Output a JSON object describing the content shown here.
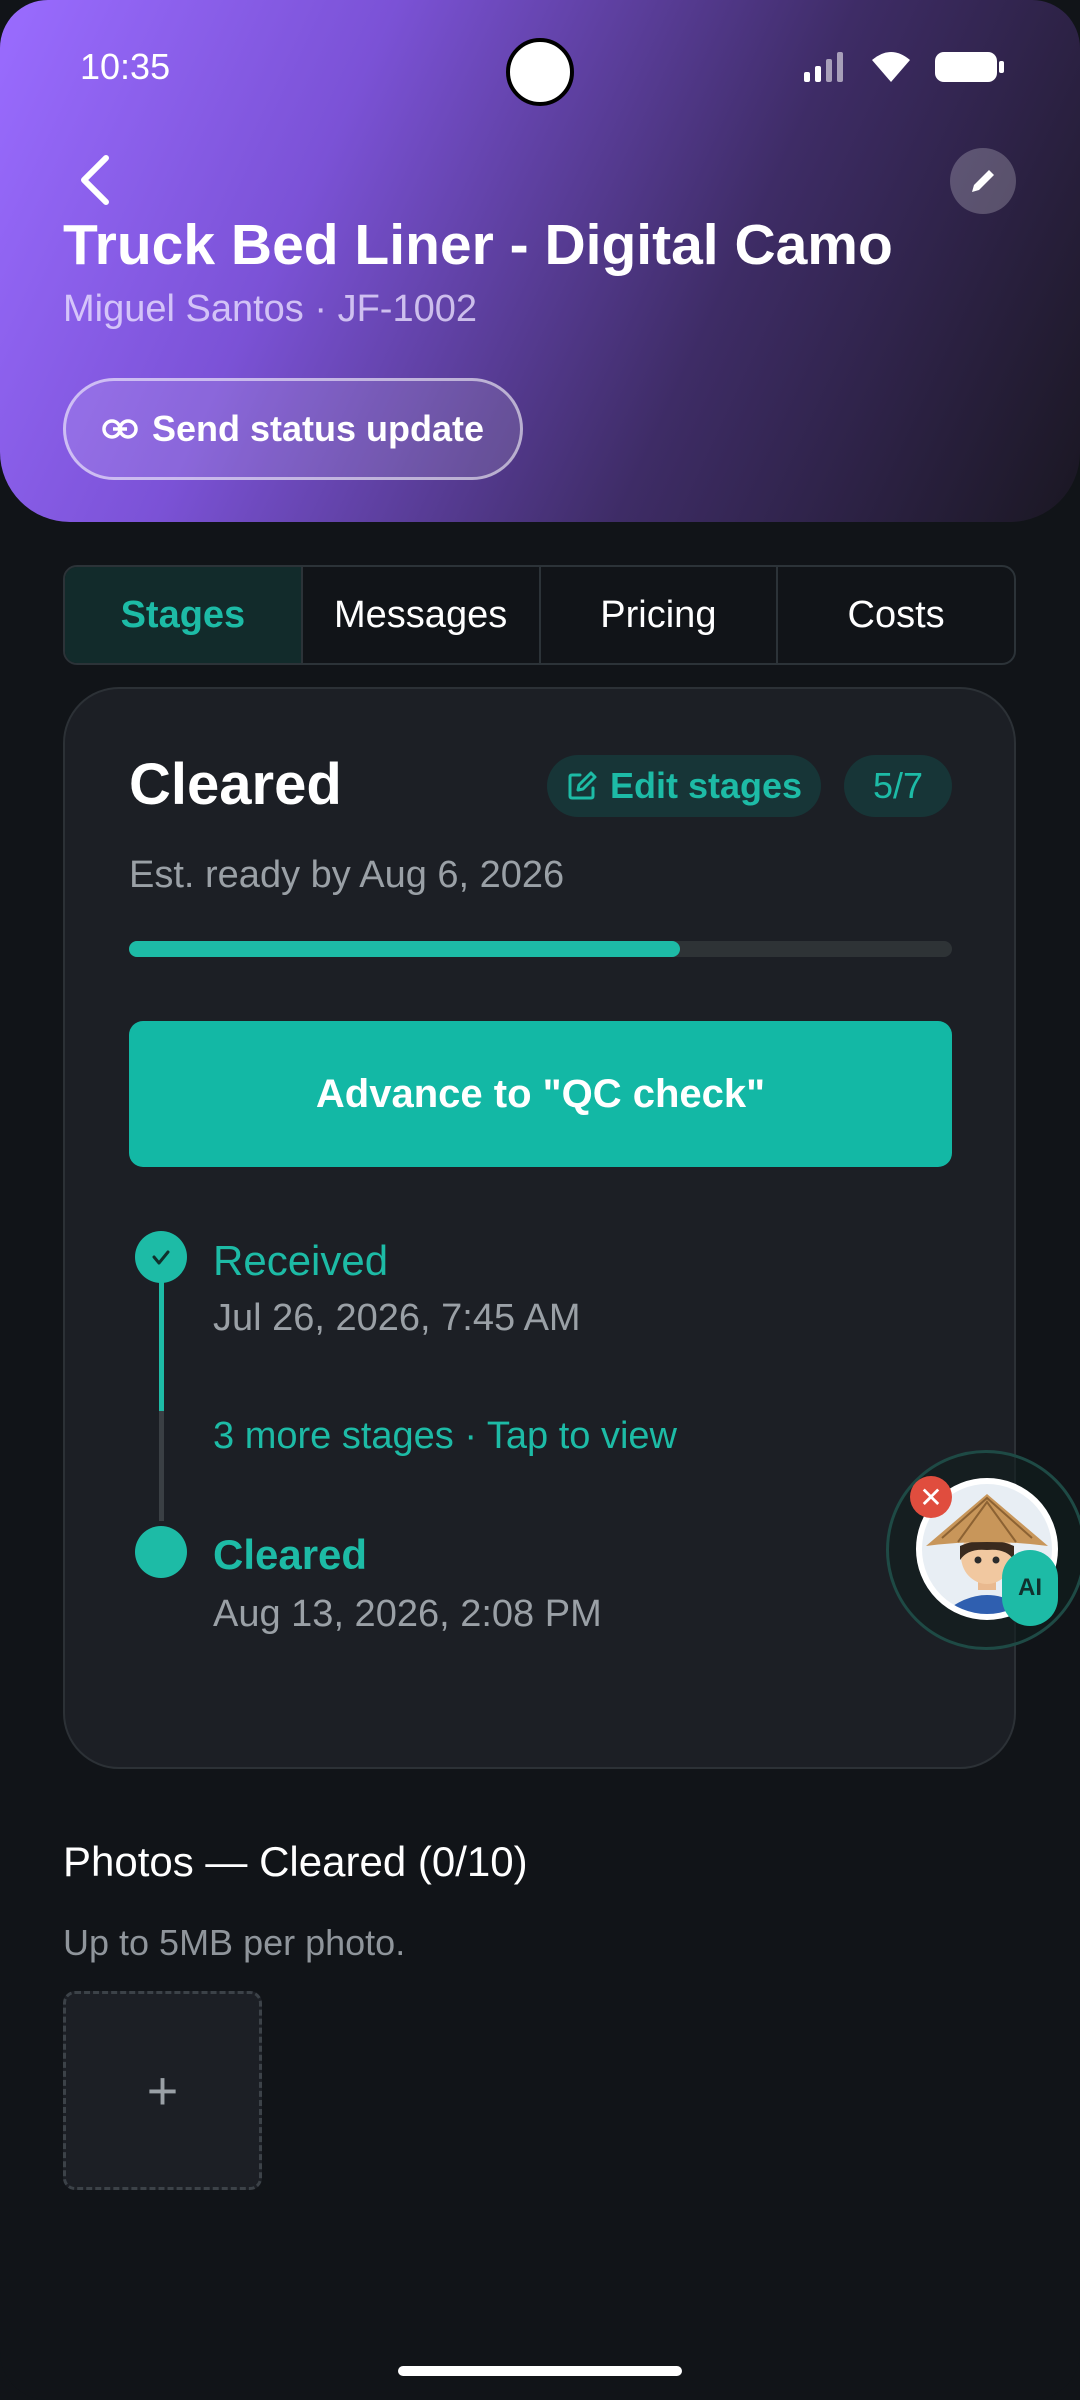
{
  "status_bar": {
    "time": "10:35",
    "signal_icon": "signal-icon",
    "wifi_icon": "wifi-icon",
    "battery_icon": "battery-icon"
  },
  "header": {
    "back_icon": "chevron-left-icon",
    "edit_icon": "pencil-icon",
    "title": "Truck Bed Liner - Digital Camo",
    "subtitle": "Miguel Santos · JF-1002",
    "send_button": {
      "icon": "link-icon",
      "label": "Send status update"
    },
    "gradient_colors": [
      "#9a6cff",
      "#1a1722"
    ]
  },
  "tabs": [
    {
      "label": "Stages",
      "active": true
    },
    {
      "label": "Messages",
      "active": false
    },
    {
      "label": "Pricing",
      "active": false
    },
    {
      "label": "Costs",
      "active": false
    }
  ],
  "stage_card": {
    "current_stage": "Cleared",
    "edit_stages_label": "Edit stages",
    "edit_stages_icon": "edit-square-icon",
    "counter": "5/7",
    "progress_fraction": 0.67,
    "est_ready": "Est. ready by Aug 6, 2026",
    "advance_label": "Advance to \"QC check\"",
    "timeline": {
      "first": {
        "name": "Received",
        "date": "Jul 26, 2026, 7:45 AM",
        "icon": "check-icon"
      },
      "more_link": "3 more stages · Tap to view",
      "current": {
        "name": "Cleared",
        "date": "Aug 13, 2026, 2:08 PM"
      }
    }
  },
  "ai_assistant": {
    "badge": "AI",
    "close_icon": "close-icon",
    "avatar": "assistant-avatar"
  },
  "photos": {
    "title": "Photos — Cleared (0/10)",
    "hint": "Up to 5MB per photo.",
    "add_label": "+"
  },
  "colors": {
    "accent": "#1dbba6",
    "background": "#111418",
    "card": "#1c1f25"
  }
}
